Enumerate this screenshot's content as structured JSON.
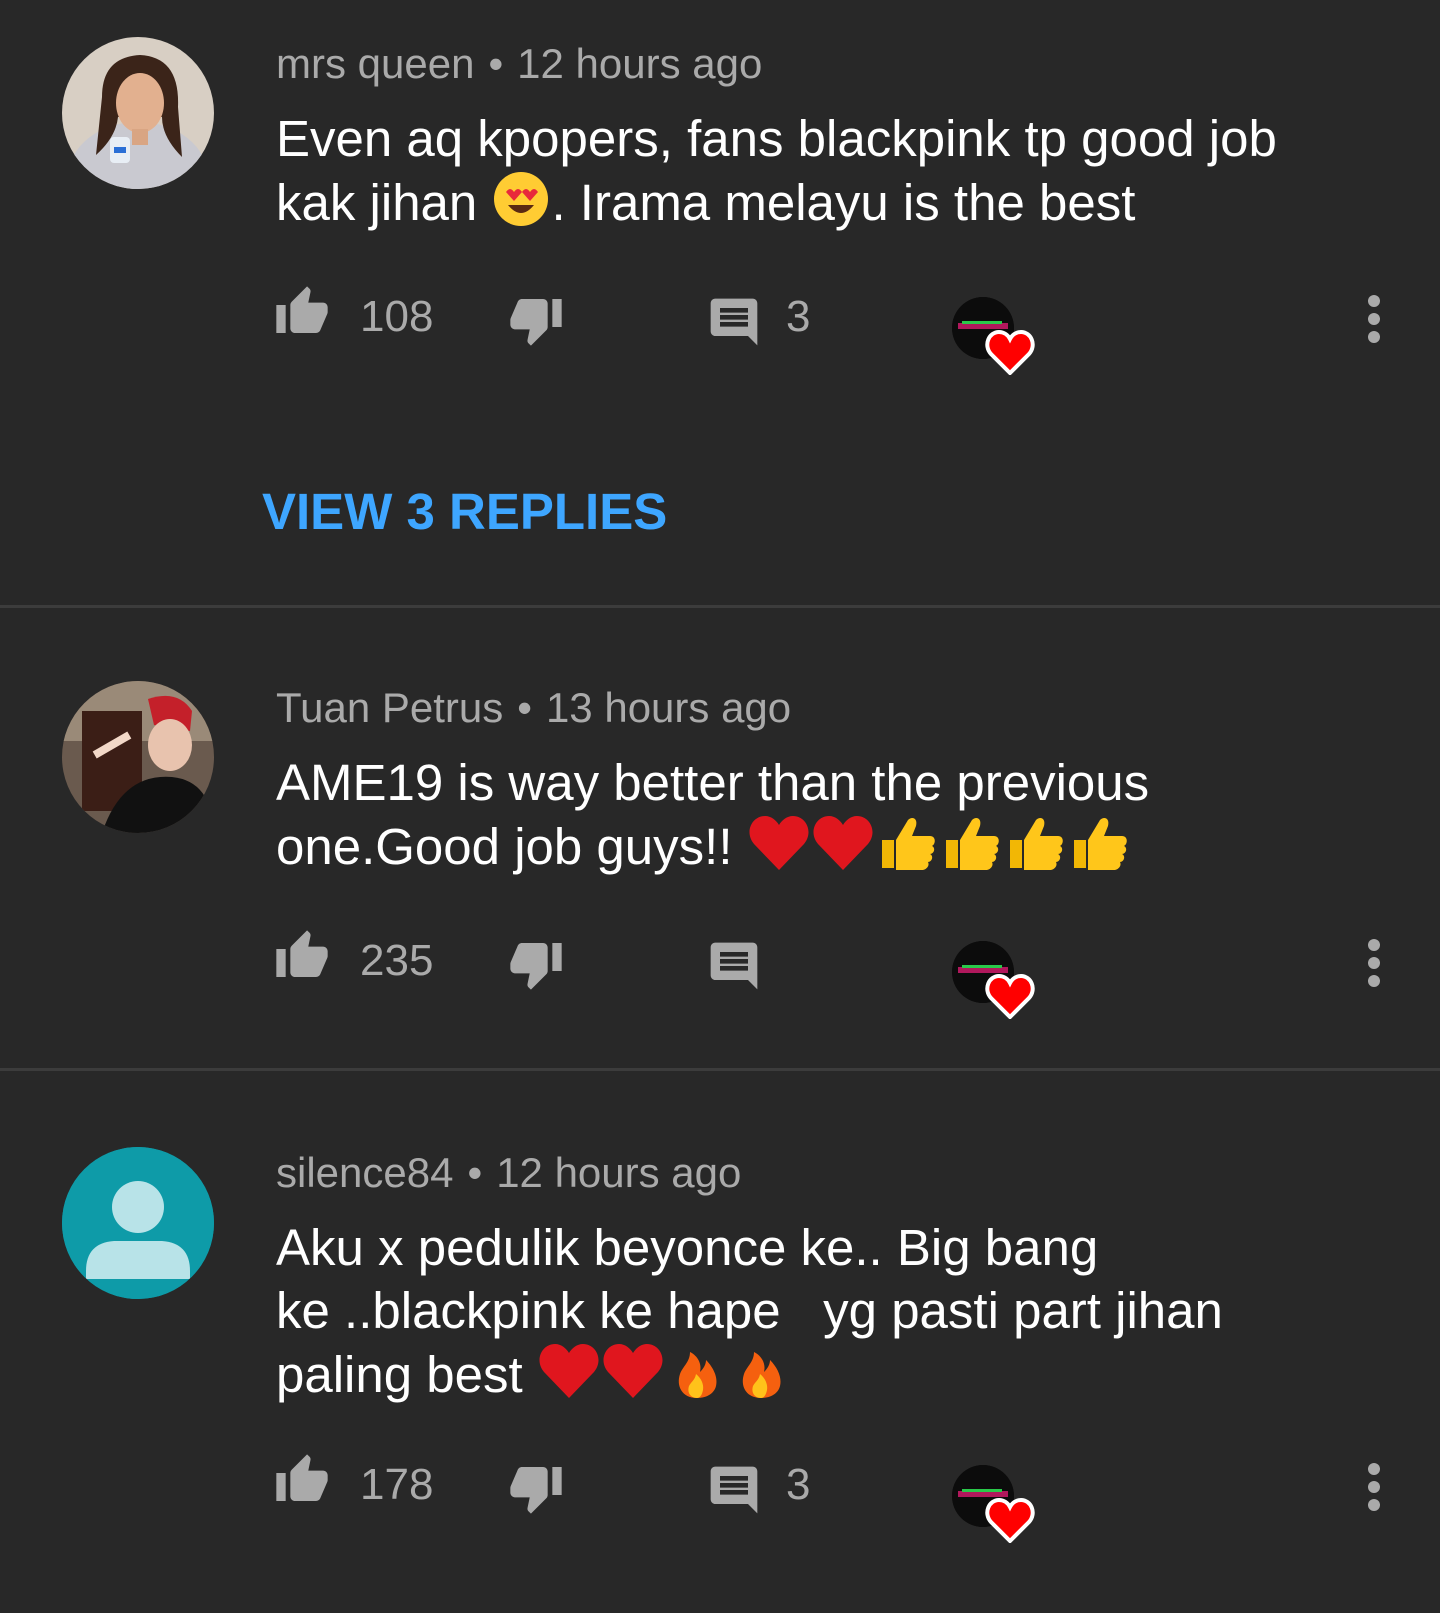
{
  "comments": [
    {
      "author": "mrs queen",
      "time": "12 hours ago",
      "text_line1": "Even aq kpopers, fans blackpink tp good job",
      "text_line2_pre": "kak jihan",
      "text_line2_post": ". Irama melayu is the best",
      "likes": "108",
      "replies": "3",
      "view_replies_label": "VIEW 3 REPLIES",
      "avatar_icon": "profile-photo"
    },
    {
      "author": "Tuan Petrus",
      "time": "13 hours ago",
      "text_line1": "AME19 is way better than the previous",
      "text_line2": "one.Good job guys!!",
      "likes": "235",
      "replies": "",
      "avatar_icon": "profile-photo"
    },
    {
      "author": "silence84",
      "time": "12 hours ago",
      "text_line1": "Aku x pedulik beyonce ke.. Big bang",
      "text_line2": "ke ..blackpink ke hape   yg pasti part jihan",
      "text_line3": "paling best",
      "likes": "178",
      "replies": "3",
      "avatar_icon": "default-person-icon"
    }
  ],
  "separator": "•",
  "colors": {
    "background": "#282828",
    "meta_text": "#aaaaaa",
    "link_blue": "#3ea6ff",
    "heart_red": "#ff0000",
    "default_avatar_bg": "#0e9ba8"
  }
}
